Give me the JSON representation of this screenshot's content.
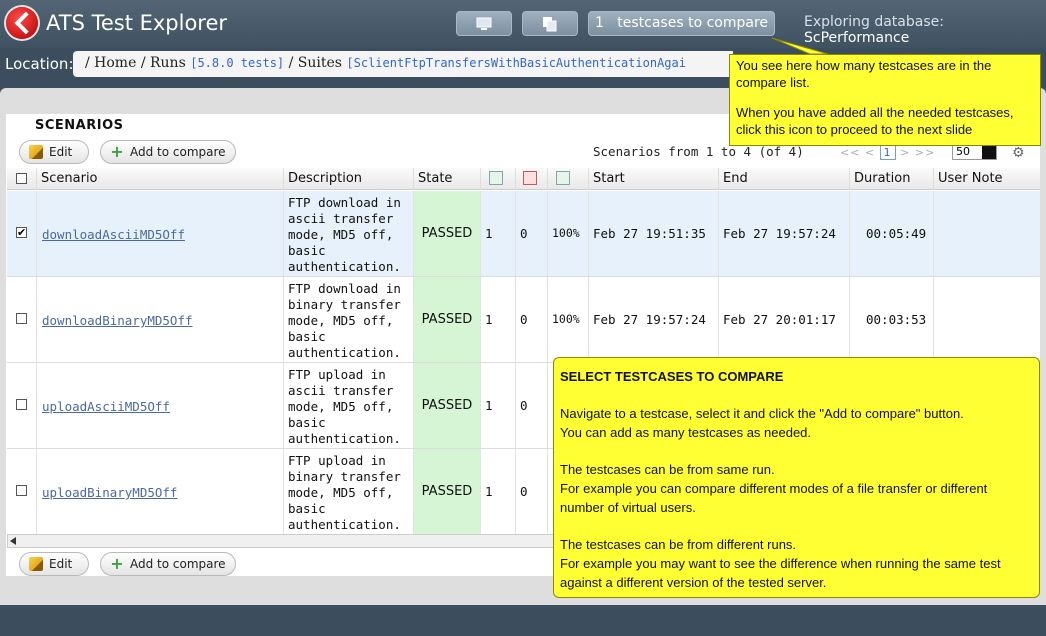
{
  "app": {
    "title": "ATS Test Explorer"
  },
  "topbar": {
    "compare_count": "1",
    "compare_label": "testcases to compare",
    "db_label": "Exploring database:",
    "db_name": "ScPerformance"
  },
  "location": {
    "label": "Location:",
    "home": "Home",
    "runs": "Runs",
    "runs_tag": "[5.8.0 tests]",
    "suites": "Suites",
    "suites_tag": "[SclientFtpTransfersWithBasicAuthenticationAgai"
  },
  "section": {
    "title": "SCENARIOS"
  },
  "toolbar": {
    "edit_label": "Edit",
    "add_label": "Add to compare"
  },
  "pager": {
    "text": "Scenarios from 1 to 4 (of 4)",
    "first": "<<",
    "prev": "<",
    "page": "1",
    "next": ">",
    "last": ">>",
    "page_size": "50"
  },
  "columns": {
    "scenario": "Scenario",
    "description": "Description",
    "state": "State",
    "start": "Start",
    "end": "End",
    "duration": "Duration",
    "user_note": "User Note"
  },
  "rows": [
    {
      "name": "downloadAsciiMD5Off",
      "description": "FTP download in\nascii transfer\nmode, MD5 off,\nbasic\nauthentication.",
      "state": "PASSED",
      "total": "1",
      "failed": "0",
      "passed_pct": "100%",
      "start": "Feb 27 19:51:35",
      "end": "Feb 27 19:57:24",
      "duration": "00:05:49",
      "checked": true
    },
    {
      "name": "downloadBinaryMD5Off",
      "description": "FTP download in\nbinary transfer\nmode, MD5 off,\nbasic\nauthentication.",
      "state": "PASSED",
      "total": "1",
      "failed": "0",
      "passed_pct": "100%",
      "start": "Feb 27 19:57:24",
      "end": "Feb 27 20:01:17",
      "duration": "00:03:53",
      "checked": false
    },
    {
      "name": "uploadAsciiMD5Off",
      "description": "FTP upload in\nascii transfer\nmode, MD5 off,\nbasic\nauthentication.",
      "state": "PASSED",
      "total": "1",
      "failed": "0",
      "checked": false
    },
    {
      "name": "uploadBinaryMD5Off",
      "description": "FTP upload in\nbinary transfer\nmode, MD5 off,\nbasic\nauthentication.",
      "state": "PASSED",
      "total": "1",
      "failed": "0",
      "checked": false
    }
  ],
  "tooltip1": {
    "line1": "You see here how many testcases are in the compare list.",
    "line2": "When you have added all the needed testcases, click this icon to proceed to the next slide"
  },
  "tooltip2": {
    "title": "SELECT TESTCASES TO COMPARE",
    "p1a": "Navigate to a testcase, select it and click the \"Add to compare\" button.",
    "p1b": "You can add as many testcases as needed.",
    "p2a": "The testcases can be from same run.",
    "p2b": "For example you can compare different modes of a file transfer or different number of virtual users.",
    "p3a": "The testcases can be from different runs.",
    "p3b": "For example you may want to see the difference when running the same test against a different version of the tested server."
  },
  "colors": {
    "tooltip": "#ffff33",
    "passed": "#d5f5d5",
    "topbar": "#4a5c6c"
  },
  "icons": [
    "logo-icon",
    "computer-icon",
    "copy-icon",
    "pencil-icon",
    "plus-icon",
    "gear-icon",
    "total-tests-icon",
    "failed-tests-icon",
    "passed-tests-icon"
  ]
}
